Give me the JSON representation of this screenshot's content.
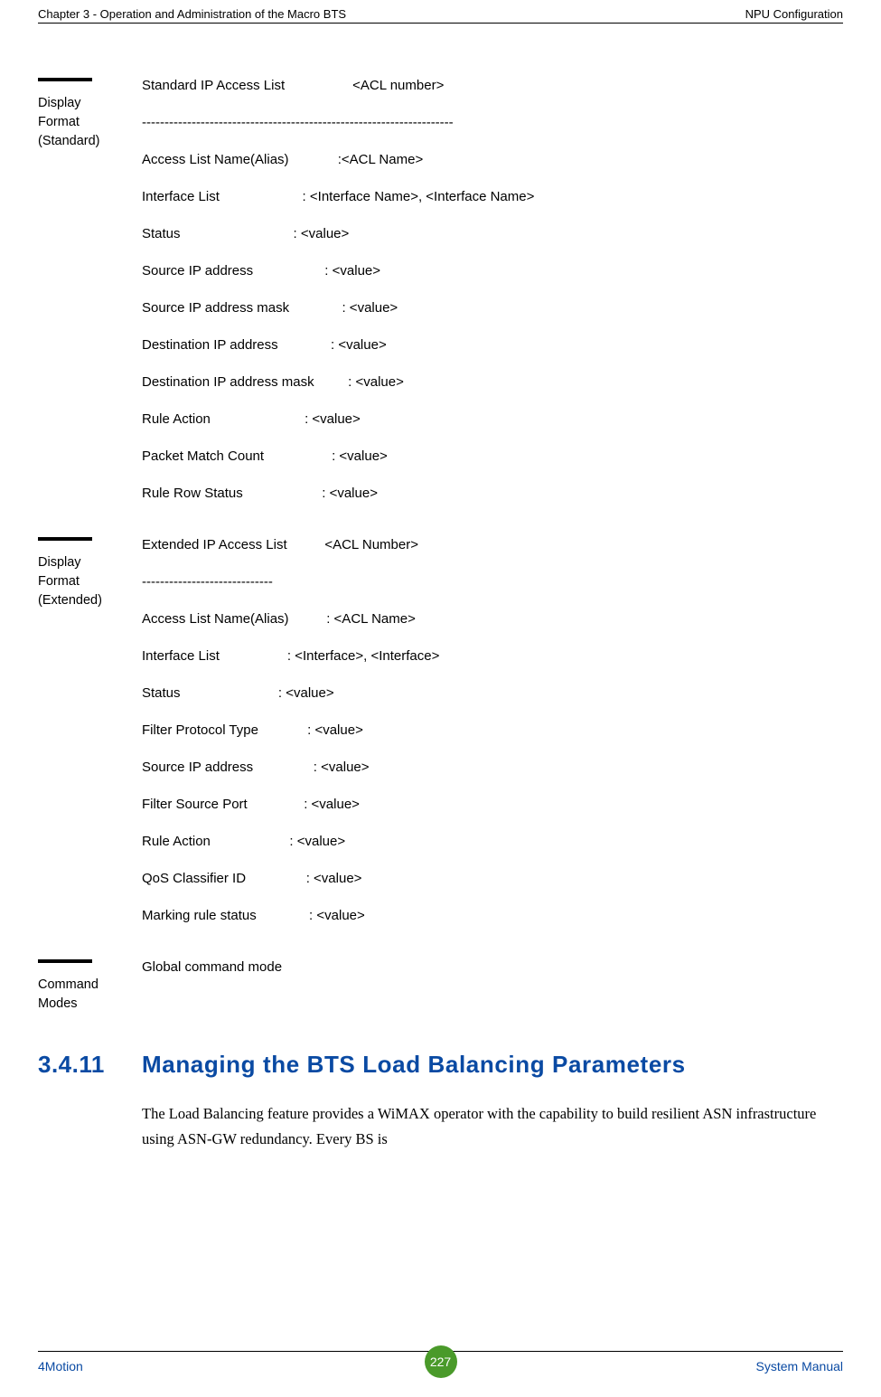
{
  "header": {
    "left": "Chapter 3 - Operation and Administration of the Macro BTS",
    "right": "NPU Configuration"
  },
  "blocks": {
    "displayFormatStandard": {
      "label": "Display\nFormat\n(Standard)",
      "lines": [
        "Standard IP Access List                  <ACL number>",
        "---------------------------------------------------------------------",
        "Access List Name(Alias)             :<ACL Name>",
        "Interface List                      : <Interface Name>, <Interface Name>",
        "Status                              : <value>",
        "Source IP address                   : <value>",
        "Source IP address mask              : <value>",
        "Destination IP address              : <value>",
        "Destination IP address mask         : <value>",
        "Rule Action                         : <value>",
        "Packet Match Count                  : <value>",
        "Rule Row Status                     : <value>"
      ]
    },
    "displayFormatExtended": {
      "label": "Display\nFormat\n(Extended)",
      "lines": [
        "Extended IP Access List          <ACL Number>",
        "-----------------------------",
        "Access List Name(Alias)          : <ACL Name>",
        "Interface List                  : <Interface>, <Interface>",
        "Status                          : <value>",
        "Filter Protocol Type             : <value>",
        "Source IP address                : <value>",
        "Filter Source Port               : <value>",
        "Rule Action                     : <value>",
        "QoS Classifier ID                : <value>",
        "Marking rule status              : <value>"
      ]
    },
    "commandModes": {
      "label": "Command\nModes",
      "lines": [
        "Global command mode"
      ]
    }
  },
  "heading": {
    "number": "3.4.11",
    "title": "Managing the BTS Load Balancing Parameters"
  },
  "paragraph": "The Load Balancing feature provides a WiMAX operator with the capability to build resilient ASN infrastructure using ASN-GW redundancy. Every BS is",
  "footer": {
    "left": "4Motion",
    "page": "227",
    "right": "System Manual"
  }
}
